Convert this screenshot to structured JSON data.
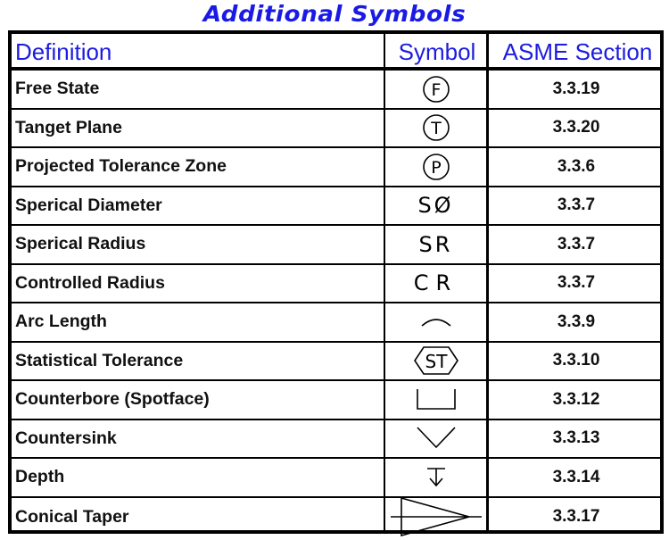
{
  "title": "Additional Symbols",
  "colors": {
    "title": "#1a1ae6",
    "header_text": "#1c1ce0",
    "border": "#000000",
    "body_text": "#111111"
  },
  "headers": {
    "definition": "Definition",
    "symbol": "Symbol",
    "section": "ASME Section"
  },
  "rows": [
    {
      "definition": "Free State",
      "symbol": "circled-F-icon",
      "symbol_text": "F",
      "section": "3.3.19"
    },
    {
      "definition": "Tanget Plane",
      "symbol": "circled-T-icon",
      "symbol_text": "T",
      "section": "3.3.20"
    },
    {
      "definition": "Projected Tolerance Zone",
      "symbol": "circled-P-icon",
      "symbol_text": "P",
      "section": "3.3.6"
    },
    {
      "definition": "Sperical Diameter",
      "symbol": "spherical-diameter-icon",
      "symbol_text": "SØ",
      "section": "3.3.7"
    },
    {
      "definition": "Sperical Radius",
      "symbol": "spherical-radius-icon",
      "symbol_text": "SR",
      "section": "3.3.7"
    },
    {
      "definition": "Controlled Radius",
      "symbol": "controlled-radius-icon",
      "symbol_text": "CR",
      "section": "3.3.7"
    },
    {
      "definition": "Arc Length",
      "symbol": "arc-length-icon",
      "symbol_text": "",
      "section": "3.3.9"
    },
    {
      "definition": "Statistical Tolerance",
      "symbol": "statistical-tolerance-icon",
      "symbol_text": "ST",
      "section": "3.3.10"
    },
    {
      "definition": "Counterbore (Spotface)",
      "symbol": "counterbore-icon",
      "symbol_text": "",
      "section": "3.3.12"
    },
    {
      "definition": "Countersink",
      "symbol": "countersink-icon",
      "symbol_text": "",
      "section": "3.3.13"
    },
    {
      "definition": "Depth",
      "symbol": "depth-icon",
      "symbol_text": "",
      "section": "3.3.14"
    },
    {
      "definition": "Conical Taper",
      "symbol": "conical-taper-icon",
      "symbol_text": "",
      "section": "3.3.17"
    }
  ]
}
